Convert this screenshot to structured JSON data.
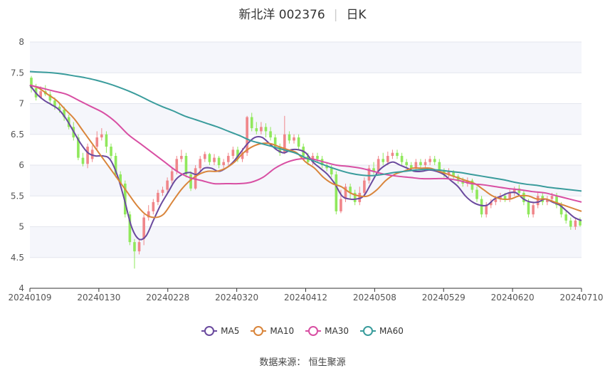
{
  "header": {
    "stock_name": "新北洋 002376",
    "period": "日K"
  },
  "source": {
    "label": "数据来源：",
    "name": "恒生聚源"
  },
  "chart_data": {
    "type": "candlestick",
    "ylim": [
      4,
      8
    ],
    "y_ticks": [
      "4",
      "4.5",
      "5",
      "5.5",
      "6",
      "6.5",
      "7",
      "7.5",
      "8"
    ],
    "x_ticks": [
      "20240109",
      "20240130",
      "20240228",
      "20240320",
      "20240412",
      "20240508",
      "20240529",
      "20240620",
      "20240710"
    ],
    "up_color": "#f0868a",
    "down_color": "#90e85c",
    "candles": [
      [
        7.42,
        7.25,
        7.45,
        7.18
      ],
      [
        7.25,
        7.1,
        7.32,
        7.05
      ],
      [
        7.1,
        7.2,
        7.28,
        7.08
      ],
      [
        7.2,
        7.15,
        7.3,
        7.12
      ],
      [
        7.15,
        7.05,
        7.2,
        7.0
      ],
      [
        7.05,
        6.95,
        7.1,
        6.9
      ],
      [
        6.95,
        6.9,
        7.02,
        6.85
      ],
      [
        6.9,
        6.78,
        6.95,
        6.72
      ],
      [
        6.78,
        6.62,
        6.82,
        6.58
      ],
      [
        6.62,
        6.45,
        6.7,
        6.4
      ],
      [
        6.45,
        6.12,
        6.5,
        6.08
      ],
      [
        6.12,
        6.02,
        6.2,
        5.98
      ],
      [
        6.02,
        6.3,
        6.35,
        5.95
      ],
      [
        6.1,
        6.25,
        6.32,
        6.05
      ],
      [
        6.3,
        6.45,
        6.55,
        6.25
      ],
      [
        6.45,
        6.5,
        6.6,
        6.4
      ],
      [
        6.5,
        6.3,
        6.55,
        6.2
      ],
      [
        6.3,
        6.15,
        6.35,
        6.1
      ],
      [
        6.15,
        5.85,
        6.2,
        5.8
      ],
      [
        5.85,
        5.7,
        5.9,
        5.65
      ],
      [
        5.7,
        5.2,
        5.75,
        5.15
      ],
      [
        5.2,
        4.75,
        5.25,
        4.7
      ],
      [
        4.75,
        4.6,
        4.8,
        4.32
      ],
      [
        4.6,
        4.75,
        4.8,
        4.55
      ],
      [
        4.8,
        5.15,
        5.2,
        4.7
      ],
      [
        5.15,
        5.25,
        5.35,
        5.1
      ],
      [
        5.25,
        5.4,
        5.45,
        5.2
      ],
      [
        5.4,
        5.55,
        5.6,
        5.35
      ],
      [
        5.55,
        5.6,
        5.65,
        5.5
      ],
      [
        5.6,
        5.75,
        5.8,
        5.55
      ],
      [
        5.75,
        5.9,
        5.95,
        5.7
      ],
      [
        5.9,
        6.1,
        6.15,
        5.85
      ],
      [
        6.1,
        6.15,
        6.25,
        6.05
      ],
      [
        6.15,
        5.85,
        6.2,
        5.8
      ],
      [
        5.85,
        5.62,
        5.9,
        5.58
      ],
      [
        5.62,
        5.95,
        6.0,
        5.6
      ],
      [
        5.95,
        6.1,
        6.15,
        5.9
      ],
      [
        6.1,
        6.18,
        6.22,
        6.05
      ],
      [
        6.18,
        6.05,
        6.2,
        6.0
      ],
      [
        6.05,
        6.12,
        6.18,
        6.0
      ],
      [
        6.12,
        6.0,
        6.15,
        5.95
      ],
      [
        6.0,
        6.05,
        6.1,
        5.95
      ],
      [
        6.05,
        6.15,
        6.2,
        6.0
      ],
      [
        6.15,
        6.25,
        6.3,
        6.1
      ],
      [
        6.25,
        6.1,
        6.3,
        6.05
      ],
      [
        6.1,
        6.2,
        6.28,
        6.05
      ],
      [
        6.2,
        6.78,
        6.8,
        6.15
      ],
      [
        6.78,
        6.6,
        6.85,
        6.55
      ],
      [
        6.6,
        6.55,
        6.7,
        6.5
      ],
      [
        6.55,
        6.62,
        6.7,
        6.5
      ],
      [
        6.62,
        6.55,
        6.68,
        6.45
      ],
      [
        6.55,
        6.45,
        6.62,
        6.4
      ],
      [
        6.45,
        6.3,
        6.5,
        6.25
      ],
      [
        6.3,
        6.2,
        6.35,
        6.15
      ],
      [
        6.2,
        6.5,
        6.8,
        6.18
      ],
      [
        6.5,
        6.4,
        6.55,
        6.35
      ],
      [
        6.4,
        6.45,
        6.5,
        6.35
      ],
      [
        6.45,
        6.3,
        6.5,
        6.25
      ],
      [
        6.3,
        6.15,
        6.35,
        6.1
      ],
      [
        6.15,
        6.05,
        6.2,
        6.0
      ],
      [
        6.05,
        6.15,
        6.2,
        6.0
      ],
      [
        6.15,
        6.1,
        6.2,
        6.05
      ],
      [
        6.1,
        6.0,
        6.15,
        5.95
      ],
      [
        6.0,
        5.95,
        6.05,
        5.9
      ],
      [
        5.95,
        5.85,
        6.0,
        5.8
      ],
      [
        5.85,
        5.25,
        5.9,
        5.2
      ],
      [
        5.25,
        5.45,
        5.6,
        5.22
      ],
      [
        5.45,
        5.65,
        5.7,
        5.4
      ],
      [
        5.65,
        5.55,
        5.7,
        5.45
      ],
      [
        5.55,
        5.4,
        5.6,
        5.35
      ],
      [
        5.4,
        5.55,
        5.65,
        5.35
      ],
      [
        5.55,
        5.75,
        5.8,
        5.5
      ],
      [
        5.75,
        5.95,
        6.0,
        5.7
      ],
      [
        5.95,
        5.9,
        6.05,
        5.85
      ],
      [
        5.9,
        6.1,
        6.15,
        5.85
      ],
      [
        6.1,
        6.05,
        6.2,
        6.0
      ],
      [
        6.05,
        6.15,
        6.22,
        6.0
      ],
      [
        6.15,
        6.2,
        6.25,
        6.1
      ],
      [
        6.2,
        6.15,
        6.25,
        6.1
      ],
      [
        6.15,
        6.05,
        6.2,
        6.0
      ],
      [
        6.05,
        6.0,
        6.1,
        5.95
      ],
      [
        6.0,
        5.95,
        6.05,
        5.9
      ],
      [
        5.95,
        6.05,
        6.1,
        5.9
      ],
      [
        6.05,
        6.0,
        6.1,
        5.95
      ],
      [
        6.0,
        6.05,
        6.1,
        5.95
      ],
      [
        6.05,
        6.1,
        6.15,
        6.0
      ],
      [
        6.1,
        6.05,
        6.15,
        6.0
      ],
      [
        6.05,
        5.92,
        6.1,
        5.88
      ],
      [
        5.92,
        5.85,
        5.95,
        5.8
      ],
      [
        5.85,
        5.9,
        5.95,
        5.8
      ],
      [
        5.9,
        5.82,
        5.92,
        5.78
      ],
      [
        5.82,
        5.75,
        5.85,
        5.7
      ],
      [
        5.75,
        5.7,
        5.8,
        5.65
      ],
      [
        5.7,
        5.75,
        5.8,
        5.65
      ],
      [
        5.75,
        5.6,
        5.78,
        5.55
      ],
      [
        5.6,
        5.45,
        5.65,
        5.4
      ],
      [
        5.45,
        5.2,
        5.5,
        5.15
      ],
      [
        5.2,
        5.35,
        5.4,
        5.15
      ],
      [
        5.35,
        5.4,
        5.45,
        5.3
      ],
      [
        5.4,
        5.45,
        5.5,
        5.35
      ],
      [
        5.45,
        5.5,
        5.55,
        5.4
      ],
      [
        5.5,
        5.45,
        5.55,
        5.4
      ],
      [
        5.45,
        5.55,
        5.6,
        5.4
      ],
      [
        5.55,
        5.62,
        5.65,
        5.5
      ],
      [
        5.62,
        5.55,
        5.68,
        5.5
      ],
      [
        5.55,
        5.4,
        5.6,
        5.35
      ],
      [
        5.4,
        5.2,
        5.45,
        5.15
      ],
      [
        5.2,
        5.35,
        5.4,
        5.15
      ],
      [
        5.35,
        5.5,
        5.55,
        5.3
      ],
      [
        5.5,
        5.4,
        5.55,
        5.35
      ],
      [
        5.4,
        5.45,
        5.5,
        5.35
      ],
      [
        5.45,
        5.5,
        5.55,
        5.4
      ],
      [
        5.5,
        5.35,
        5.55,
        5.3
      ],
      [
        5.35,
        5.2,
        5.4,
        5.15
      ],
      [
        5.2,
        5.1,
        5.25,
        5.05
      ],
      [
        5.1,
        5.0,
        5.15,
        4.95
      ],
      [
        5.0,
        5.1,
        5.15,
        4.95
      ],
      [
        5.1,
        5.02,
        5.15,
        5.0
      ]
    ],
    "series": [
      {
        "name": "MA5",
        "color": "#6a4a9e",
        "values": [
          7.3,
          7.15,
          7.05,
          6.98,
          6.9,
          6.75,
          6.55,
          6.35,
          6.2,
          6.15,
          6.15,
          6.1,
          5.85,
          5.45,
          5.0,
          4.8,
          4.85,
          5.1,
          5.35,
          5.55,
          5.75,
          5.85,
          5.88,
          5.85,
          5.95,
          5.95,
          5.9,
          5.95,
          6.05,
          6.2,
          6.35,
          6.45,
          6.45,
          6.35,
          6.25,
          6.2,
          6.25,
          6.25,
          6.2,
          6.05,
          5.95,
          5.85,
          5.7,
          5.5,
          5.45,
          5.45,
          5.5,
          5.7,
          5.9,
          6.0,
          6.05,
          6.0,
          5.95,
          5.9,
          5.9,
          5.92,
          5.9,
          5.85,
          5.75,
          5.65,
          5.5,
          5.4,
          5.35,
          5.35,
          5.45,
          5.5,
          5.55,
          5.55,
          5.45,
          5.4,
          5.4,
          5.45,
          5.4,
          5.35,
          5.25,
          5.15,
          5.1
        ]
      },
      {
        "name": "MA10",
        "color": "#d9853b",
        "values": [
          7.3,
          7.25,
          7.15,
          7.05,
          6.9,
          6.75,
          6.55,
          6.35,
          6.15,
          5.95,
          5.75,
          5.55,
          5.35,
          5.2,
          5.15,
          5.2,
          5.4,
          5.6,
          5.75,
          5.85,
          5.9,
          5.9,
          5.95,
          6.05,
          6.2,
          6.3,
          6.35,
          6.35,
          6.3,
          6.25,
          6.2,
          6.05,
          5.95,
          5.8,
          5.7,
          5.65,
          5.55,
          5.5,
          5.5,
          5.6,
          5.75,
          5.85,
          5.9,
          5.95,
          5.95,
          5.95,
          5.9,
          5.85,
          5.8,
          5.75,
          5.7,
          5.6,
          5.5,
          5.45,
          5.45,
          5.5,
          5.5,
          5.45,
          5.45,
          5.4,
          5.35,
          5.3,
          5.25
        ]
      },
      {
        "name": "MA30",
        "color": "#d84fa3",
        "values": [
          7.3,
          7.25,
          7.2,
          7.15,
          7.05,
          6.95,
          6.85,
          6.7,
          6.5,
          6.35,
          6.2,
          6.05,
          5.9,
          5.8,
          5.75,
          5.7,
          5.7,
          5.7,
          5.72,
          5.8,
          5.95,
          6.05,
          6.1,
          6.1,
          6.05,
          6.0,
          5.98,
          5.95,
          5.9,
          5.85,
          5.82,
          5.8,
          5.78,
          5.78,
          5.78,
          5.75,
          5.7,
          5.68,
          5.65,
          5.62,
          5.6,
          5.57,
          5.55,
          5.5,
          5.45,
          5.4
        ]
      },
      {
        "name": "MA60",
        "color": "#3a9c9c",
        "values": [
          7.52,
          7.51,
          7.5,
          7.48,
          7.45,
          7.42,
          7.38,
          7.33,
          7.27,
          7.2,
          7.12,
          7.03,
          6.95,
          6.88,
          6.8,
          6.74,
          6.68,
          6.62,
          6.55,
          6.48,
          6.4,
          6.35,
          6.3,
          6.25,
          6.2,
          6.12,
          6.05,
          5.98,
          5.92,
          5.87,
          5.84,
          5.83,
          5.85,
          5.88,
          5.9,
          5.92,
          5.93,
          5.92,
          5.9,
          5.88,
          5.85,
          5.82,
          5.79,
          5.76,
          5.72,
          5.69,
          5.67,
          5.64,
          5.62,
          5.6,
          5.58
        ]
      }
    ],
    "grid": true,
    "legend_position": "bottom"
  }
}
